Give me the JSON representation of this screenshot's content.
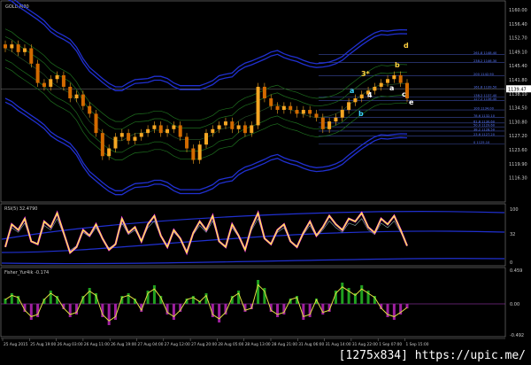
{
  "window": {
    "symbol_label": "GOLD,M30"
  },
  "colors": {
    "bull": "#f5a623",
    "bear": "#d26a00",
    "band_blue": "#2030d0",
    "band_green": "#1e6e1e",
    "rsi": "#ffff30",
    "rsi_alt": "#ff30ff",
    "fisher_pos": "#20a020",
    "fisher_neg": "#a020a0",
    "fib": "#3a4aa0"
  },
  "watermark": "[1275x834] https://upic.me/",
  "chart_data": [
    {
      "type": "candlestick",
      "title": "GOLD,M30",
      "ylim": [
        1114,
        1162
      ],
      "y_ticks": [
        "1160.00",
        "1156.40",
        "1152.70",
        "1149.10",
        "1145.40",
        "1141.80",
        "1138.10",
        "1134.50",
        "1130.80",
        "1127.20",
        "1123.60",
        "1119.90",
        "1116.30"
      ],
      "current_price": "1139.47",
      "closes": [
        1150,
        1151,
        1149,
        1150,
        1146,
        1141,
        1140,
        1142,
        1143,
        1140,
        1137,
        1138,
        1135,
        1133,
        1128,
        1122,
        1124,
        1127,
        1128,
        1126,
        1127,
        1128,
        1129,
        1130,
        1128,
        1129,
        1130,
        1127,
        1124,
        1121,
        1125,
        1128,
        1129,
        1130,
        1131,
        1129,
        1130,
        1128,
        1130,
        1140,
        1137,
        1135,
        1134,
        1135,
        1134,
        1133,
        1134,
        1133,
        1132,
        1129,
        1131,
        1132,
        1134,
        1136,
        1137,
        1138,
        1139,
        1140,
        1141,
        1142,
        1143,
        1141,
        1137
      ],
      "wave_labels": [
        "a",
        "b",
        "3*",
        "4",
        "d",
        "b",
        "a",
        "c",
        "e"
      ],
      "fib_levels": [
        {
          "level": "261.8",
          "price": "1148.40"
        },
        {
          "level": "238.2",
          "price": "1146.30"
        },
        {
          "level": "200",
          "price": "1142.90"
        },
        {
          "level": "161.8",
          "price": "1139.50"
        },
        {
          "level": "138.2",
          "price": "1137.40"
        },
        {
          "level": "127.2",
          "price": "1136.40"
        },
        {
          "level": "100",
          "price": "1134.00"
        },
        {
          "level": "78.6",
          "price": "1132.10"
        },
        {
          "level": "61.8",
          "price": "1130.60"
        },
        {
          "level": "50.0",
          "price": "1129.60"
        },
        {
          "level": "38.2",
          "price": "1128.50"
        },
        {
          "level": "23.6",
          "price": "1127.20"
        },
        {
          "level": "0",
          "price": "1125.10"
        }
      ]
    },
    {
      "type": "line",
      "title": "RSI(5) 32.4790",
      "ylim": [
        0,
        100
      ],
      "y_ticks": [
        "100",
        "32",
        "0"
      ],
      "values": [
        30,
        70,
        60,
        80,
        40,
        35,
        75,
        65,
        90,
        55,
        20,
        30,
        60,
        50,
        70,
        45,
        25,
        35,
        80,
        55,
        65,
        40,
        70,
        85,
        50,
        30,
        60,
        45,
        20,
        55,
        75,
        60,
        85,
        40,
        30,
        70,
        50,
        25,
        65,
        90,
        45,
        35,
        60,
        70,
        40,
        30,
        55,
        75,
        50,
        65,
        85,
        70,
        60,
        80,
        75,
        90,
        65,
        55,
        80,
        70,
        85,
        60,
        32
      ],
      "upper_band_label": "",
      "lower_band_label": ""
    },
    {
      "type": "bar",
      "title": "Fisher_Yur4ik -0.174",
      "ylim": [
        -1.2,
        1.2
      ],
      "y_ticks": [
        "0.459",
        "0.00",
        "-0.492"
      ],
      "values": [
        0.2,
        0.4,
        0.3,
        -0.3,
        -0.6,
        -0.5,
        0.2,
        0.5,
        0.3,
        -0.2,
        -0.5,
        -0.4,
        0.3,
        0.6,
        0.4,
        -0.5,
        -0.8,
        -0.6,
        0.3,
        0.4,
        0.2,
        -0.3,
        0.5,
        0.7,
        0.3,
        -0.4,
        -0.6,
        -0.3,
        0.2,
        0.3,
        0.1,
        0.4,
        -0.5,
        -0.7,
        -0.4,
        0.3,
        0.5,
        -0.3,
        -0.2,
        0.9,
        0.6,
        -0.3,
        -0.5,
        -0.4,
        0.2,
        0.3,
        -0.6,
        -0.5,
        0.2,
        -0.4,
        -0.3,
        0.5,
        0.8,
        0.6,
        0.4,
        0.7,
        0.5,
        0.3,
        -0.2,
        -0.5,
        -0.6,
        -0.4,
        -0.17
      ]
    }
  ],
  "time_axis": [
    "25 Aug 2015",
    "25 Aug 19:00",
    "26 Aug 03:00",
    "26 Aug 11:00",
    "26 Aug 19:00",
    "27 Aug 04:00",
    "27 Aug 12:00",
    "27 Aug 20:00",
    "28 Aug 05:00",
    "28 Aug 13:00",
    "28 Aug 21:00",
    "31 Aug 06:00",
    "31 Aug 14:00",
    "31 Aug 22:00",
    "1 Sep 07:00",
    "1 Sep 15:00"
  ]
}
